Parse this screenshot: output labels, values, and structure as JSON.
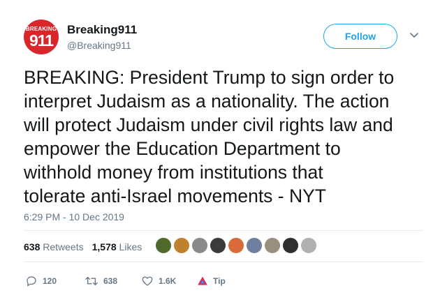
{
  "account": {
    "avatar_top_text": "BREAKING",
    "avatar_number": "911",
    "display_name": "Breaking911",
    "handle": "@Breaking911"
  },
  "follow_label": "Follow",
  "tweet": {
    "text": "BREAKING: President Trump to sign order to\ninterpret Judaism as a nationality. The action\nwill protect Judaism under civil rights law and\nempower the Education Department to\nwithhold money from institutions that\ntolerate anti-Israel movements - NYT",
    "timestamp": "6:29 PM - 10 Dec 2019"
  },
  "stats": {
    "retweets_count": "638",
    "retweets_label": "Retweets",
    "likes_count": "1,578",
    "likes_label": "Likes"
  },
  "liker_avatar_colors": [
    "#4f6b2c",
    "#c0812f",
    "#8a8a8a",
    "#3b3b3b",
    "#d96a3a",
    "#6f7fa0",
    "#9a8f7f",
    "#2f2f2f",
    "#b0b0b0"
  ],
  "actions": {
    "reply_count": "120",
    "retweet_count": "638",
    "like_count": "1.6K",
    "tip_label": "Tip"
  },
  "colors": {
    "brand_blue": "#1da1f2",
    "avatar_red": "#d9262b",
    "secondary_text": "#657786"
  }
}
